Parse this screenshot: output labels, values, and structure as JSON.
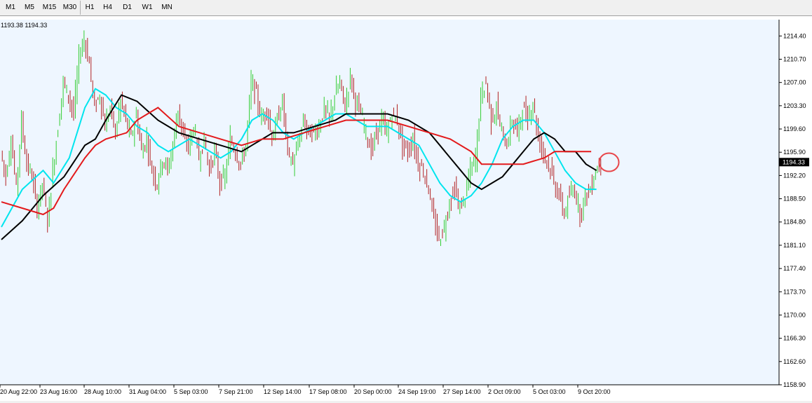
{
  "toolbar": {
    "timeframes": [
      "M1",
      "M5",
      "M15",
      "M30",
      "H1",
      "H4",
      "D1",
      "W1",
      "MN"
    ]
  },
  "chart_data": {
    "type": "candlestick",
    "title": "",
    "ohlc_readout": "1193.38 1194.33",
    "current_price_label": "1194.33",
    "ylim": [
      1158.9,
      1217.0
    ],
    "y_ticks": [
      "1214.40",
      "1210.70",
      "1207.00",
      "1203.30",
      "1199.60",
      "1195.90",
      "1192.20",
      "1188.50",
      "1184.80",
      "1181.10",
      "1177.40",
      "1173.70",
      "1170.00",
      "1166.30",
      "1162.60",
      "1158.90"
    ],
    "x_ticks": [
      "20 Aug 22:00",
      "23 Aug 16:00",
      "28 Aug 10:00",
      "31 Aug 04:00",
      "5 Sep 03:00",
      "7 Sep 21:00",
      "12 Sep 14:00",
      "17 Sep 08:00",
      "20 Sep 00:00",
      "24 Sep 19:00",
      "27 Sep 14:00",
      "2 Oct 09:00",
      "5 Oct 03:00",
      "9 Oct 20:00"
    ],
    "colors": {
      "background": "#eef6ff",
      "grid_border": "#000000",
      "bull_candle": "#32cd32",
      "bear_candle": "#b22222",
      "ma_fast": "#00e5ee",
      "ma_mid": "#000000",
      "ma_slow": "#e31a1c",
      "annotation_circle": "#e8474b"
    },
    "price_path": [
      [
        0,
        1196
      ],
      [
        1,
        1192
      ],
      [
        2,
        1198
      ],
      [
        3,
        1190
      ],
      [
        4,
        1201
      ],
      [
        5,
        1194
      ],
      [
        6,
        1192
      ],
      [
        7,
        1187
      ],
      [
        8,
        1191
      ],
      [
        9,
        1185
      ],
      [
        10,
        1193
      ],
      [
        11,
        1200
      ],
      [
        12,
        1207
      ],
      [
        13,
        1205
      ],
      [
        14,
        1202
      ],
      [
        15,
        1211
      ],
      [
        16,
        1214
      ],
      [
        17,
        1210
      ],
      [
        18,
        1203
      ],
      [
        19,
        1205
      ],
      [
        20,
        1200
      ],
      [
        21,
        1203
      ],
      [
        22,
        1199
      ],
      [
        23,
        1204
      ],
      [
        24,
        1201
      ],
      [
        25,
        1198
      ],
      [
        26,
        1202
      ],
      [
        27,
        1196
      ],
      [
        28,
        1198
      ],
      [
        29,
        1193
      ],
      [
        30,
        1191
      ],
      [
        31,
        1195
      ],
      [
        32,
        1193
      ],
      [
        33,
        1197
      ],
      [
        34,
        1203
      ],
      [
        35,
        1198
      ],
      [
        36,
        1197
      ],
      [
        37,
        1200
      ],
      [
        38,
        1195
      ],
      [
        39,
        1198
      ],
      [
        40,
        1193
      ],
      [
        41,
        1196
      ],
      [
        42,
        1191
      ],
      [
        43,
        1192
      ],
      [
        44,
        1198
      ],
      [
        45,
        1196
      ],
      [
        46,
        1194
      ],
      [
        47,
        1197
      ],
      [
        48,
        1207
      ],
      [
        49,
        1205
      ],
      [
        50,
        1201
      ],
      [
        51,
        1203
      ],
      [
        52,
        1198
      ],
      [
        53,
        1201
      ],
      [
        54,
        1204
      ],
      [
        55,
        1196
      ],
      [
        56,
        1194
      ],
      [
        57,
        1197
      ],
      [
        58,
        1201
      ],
      [
        59,
        1199
      ],
      [
        60,
        1199
      ],
      [
        61,
        1200
      ],
      [
        62,
        1203
      ],
      [
        63,
        1201
      ],
      [
        64,
        1205
      ],
      [
        65,
        1207
      ],
      [
        66,
        1203
      ],
      [
        67,
        1208
      ],
      [
        68,
        1204
      ],
      [
        69,
        1202
      ],
      [
        70,
        1199
      ],
      [
        71,
        1196
      ],
      [
        72,
        1199
      ],
      [
        73,
        1201
      ],
      [
        74,
        1199
      ],
      [
        75,
        1202
      ],
      [
        76,
        1201
      ],
      [
        77,
        1197
      ],
      [
        78,
        1196
      ],
      [
        79,
        1198
      ],
      [
        80,
        1194
      ],
      [
        81,
        1193
      ],
      [
        82,
        1190
      ],
      [
        83,
        1185
      ],
      [
        84,
        1182
      ],
      [
        85,
        1184
      ],
      [
        86,
        1188
      ],
      [
        87,
        1190
      ],
      [
        88,
        1187
      ],
      [
        89,
        1189
      ],
      [
        90,
        1193
      ],
      [
        91,
        1195
      ],
      [
        92,
        1205
      ],
      [
        93,
        1207
      ],
      [
        94,
        1201
      ],
      [
        95,
        1203
      ],
      [
        96,
        1199
      ],
      [
        97,
        1197
      ],
      [
        98,
        1201
      ],
      [
        99,
        1199
      ],
      [
        100,
        1203
      ],
      [
        101,
        1201
      ],
      [
        102,
        1204
      ],
      [
        103,
        1198
      ],
      [
        104,
        1196
      ],
      [
        105,
        1194
      ],
      [
        106,
        1191
      ],
      [
        107,
        1189
      ],
      [
        108,
        1186
      ],
      [
        109,
        1189
      ],
      [
        110,
        1190
      ],
      [
        111,
        1186
      ],
      [
        112,
        1189
      ],
      [
        113,
        1190
      ],
      [
        114,
        1193
      ],
      [
        115,
        1194.33
      ]
    ],
    "series": [
      {
        "name": "",
        "color": "#00e5ee",
        "points": [
          [
            0,
            1184
          ],
          [
            4,
            1190
          ],
          [
            8,
            1193
          ],
          [
            10,
            1191
          ],
          [
            13,
            1195
          ],
          [
            16,
            1203
          ],
          [
            18,
            1206
          ],
          [
            20,
            1205
          ],
          [
            22,
            1203
          ],
          [
            24,
            1202
          ],
          [
            26,
            1200
          ],
          [
            28,
            1199
          ],
          [
            30,
            1197
          ],
          [
            32,
            1196
          ],
          [
            34,
            1197
          ],
          [
            36,
            1198
          ],
          [
            38,
            1197
          ],
          [
            40,
            1196
          ],
          [
            42,
            1195
          ],
          [
            44,
            1196
          ],
          [
            46,
            1198
          ],
          [
            48,
            1201
          ],
          [
            50,
            1202
          ],
          [
            52,
            1201
          ],
          [
            54,
            1199
          ],
          [
            56,
            1198
          ],
          [
            58,
            1199
          ],
          [
            60,
            1200
          ],
          [
            62,
            1201
          ],
          [
            64,
            1202
          ],
          [
            66,
            1202
          ],
          [
            68,
            1201
          ],
          [
            70,
            1200
          ],
          [
            72,
            1200
          ],
          [
            74,
            1200
          ],
          [
            76,
            1199
          ],
          [
            78,
            1198
          ],
          [
            80,
            1197
          ],
          [
            82,
            1194
          ],
          [
            84,
            1191
          ],
          [
            86,
            1189
          ],
          [
            88,
            1188
          ],
          [
            90,
            1189
          ],
          [
            92,
            1191
          ],
          [
            94,
            1194
          ],
          [
            96,
            1198
          ],
          [
            98,
            1200
          ],
          [
            100,
            1201
          ],
          [
            102,
            1201
          ],
          [
            104,
            1199
          ],
          [
            106,
            1196
          ],
          [
            108,
            1193
          ],
          [
            110,
            1191
          ],
          [
            112,
            1190
          ],
          [
            114,
            1190
          ]
        ]
      },
      {
        "name": "",
        "color": "#000000",
        "points": [
          [
            0,
            1182
          ],
          [
            4,
            1185
          ],
          [
            8,
            1189
          ],
          [
            12,
            1192
          ],
          [
            16,
            1197
          ],
          [
            18,
            1198
          ],
          [
            20,
            1201
          ],
          [
            23,
            1205
          ],
          [
            26,
            1204
          ],
          [
            30,
            1201
          ],
          [
            34,
            1199
          ],
          [
            38,
            1198
          ],
          [
            42,
            1197
          ],
          [
            46,
            1196
          ],
          [
            48,
            1197
          ],
          [
            52,
            1199
          ],
          [
            56,
            1199
          ],
          [
            60,
            1200
          ],
          [
            64,
            1201
          ],
          [
            66,
            1202
          ],
          [
            70,
            1202
          ],
          [
            74,
            1202
          ],
          [
            78,
            1201
          ],
          [
            82,
            1199
          ],
          [
            84,
            1197
          ],
          [
            86,
            1195
          ],
          [
            88,
            1193
          ],
          [
            90,
            1191
          ],
          [
            92,
            1190
          ],
          [
            94,
            1191
          ],
          [
            96,
            1192
          ],
          [
            98,
            1194
          ],
          [
            100,
            1196
          ],
          [
            102,
            1198
          ],
          [
            104,
            1199
          ],
          [
            106,
            1198
          ],
          [
            108,
            1196
          ],
          [
            110,
            1196
          ],
          [
            112,
            1194
          ],
          [
            114,
            1193
          ]
        ]
      },
      {
        "name": "",
        "color": "#e31a1c",
        "points": [
          [
            0,
            1188
          ],
          [
            4,
            1187
          ],
          [
            8,
            1186
          ],
          [
            10,
            1187
          ],
          [
            12,
            1190
          ],
          [
            16,
            1195
          ],
          [
            18,
            1197
          ],
          [
            20,
            1198
          ],
          [
            24,
            1199
          ],
          [
            26,
            1201
          ],
          [
            28,
            1202
          ],
          [
            30,
            1203
          ],
          [
            34,
            1200
          ],
          [
            38,
            1199
          ],
          [
            42,
            1198
          ],
          [
            46,
            1197
          ],
          [
            50,
            1198
          ],
          [
            54,
            1198
          ],
          [
            58,
            1199
          ],
          [
            62,
            1200
          ],
          [
            66,
            1201
          ],
          [
            70,
            1201
          ],
          [
            74,
            1201
          ],
          [
            78,
            1200
          ],
          [
            82,
            1199
          ],
          [
            86,
            1198
          ],
          [
            90,
            1196
          ],
          [
            92,
            1194
          ],
          [
            96,
            1194
          ],
          [
            100,
            1194
          ],
          [
            104,
            1195
          ],
          [
            106,
            1196
          ],
          [
            110,
            1196
          ],
          [
            113,
            1196
          ]
        ]
      }
    ],
    "annotation": {
      "shape": "circle",
      "x": 114.8,
      "y": 1194.3
    }
  }
}
